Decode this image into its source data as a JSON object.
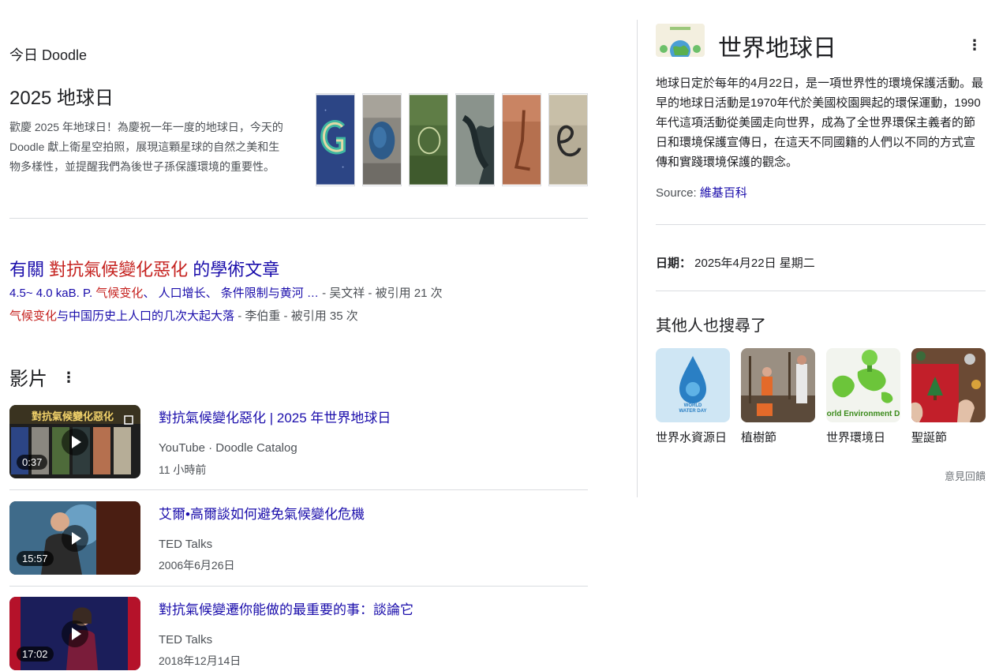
{
  "doodle": {
    "label": "今日 Doodle",
    "title": "2025 地球日",
    "description": "歡慶 2025 年地球日！為慶祝一年一度的地球日，今天的 Doodle 獻上衛星空拍照，展現這顆星球的自然之美和生物多樣性，並提醒我們為後世子孫保護環境的重要性。"
  },
  "scholar": {
    "title_prefix": "有關 ",
    "title_highlight": "對抗氣候變化惡化",
    "title_suffix": " 的學術文章",
    "articles": [
      {
        "pre": "4.5~ 4.0 kaB. P. ",
        "hl": "气候变化",
        "post": "、 人口增长、 条件限制与黄河 …",
        "meta": " - 吴文祥 - 被引用 21 次"
      },
      {
        "pre": "",
        "hl": "气候变化",
        "post": "与中国历史上人口的几次大起大落",
        "meta": " - 李伯重 - 被引用 35 次"
      }
    ]
  },
  "videos": {
    "heading": "影片",
    "menu_icon": "⋮",
    "items": [
      {
        "title": "對抗氣候變化惡化 | 2025 年世界地球日",
        "source": "YouTube · Doodle Catalog",
        "date": "11 小時前",
        "duration": "0:37",
        "overlay_text": "對抗氣候變化惡化"
      },
      {
        "title": "艾爾•高爾談如何避免氣候變化危機",
        "source": "TED Talks",
        "date": "2006年6月26日",
        "duration": "15:57"
      },
      {
        "title": "對抗氣候變遷你能做的最重要的事：談論它",
        "source": "TED Talks",
        "date": "2018年12月14日",
        "duration": "17:02"
      }
    ]
  },
  "knowledge_panel": {
    "title": "世界地球日",
    "menu_icon": "⋮",
    "description": "地球日定於每年的4月22日，是一項世界性的環境保護活動。最早的地球日活動是1970年代於美國校園興起的環保運動，1990年代這項活動從美國走向世界，成為了全世界環保主義者的節日和環境保護宣傳日，在這天不同國籍的人們以不同的方式宣傳和實踐環境保護的觀念。",
    "source_label": "Source: ",
    "source_link": "維基百科",
    "date_label": "日期：",
    "date_value": " 2025年4月22日 星期二",
    "people_also_search": {
      "heading": "其他人也搜尋了",
      "items": [
        {
          "label": "世界水資源日",
          "img_text_1": "WORLD",
          "img_text_2": "WATER DAY"
        },
        {
          "label": "植樹節"
        },
        {
          "label": "世界環境日",
          "img_text": "orld Environment D"
        },
        {
          "label": "聖誕節"
        }
      ]
    },
    "feedback": "意見回饋"
  },
  "colors": {
    "link": "#1a0dab",
    "highlight": "#c5221f",
    "muted": "#4d5156",
    "divider": "#dadce0"
  }
}
